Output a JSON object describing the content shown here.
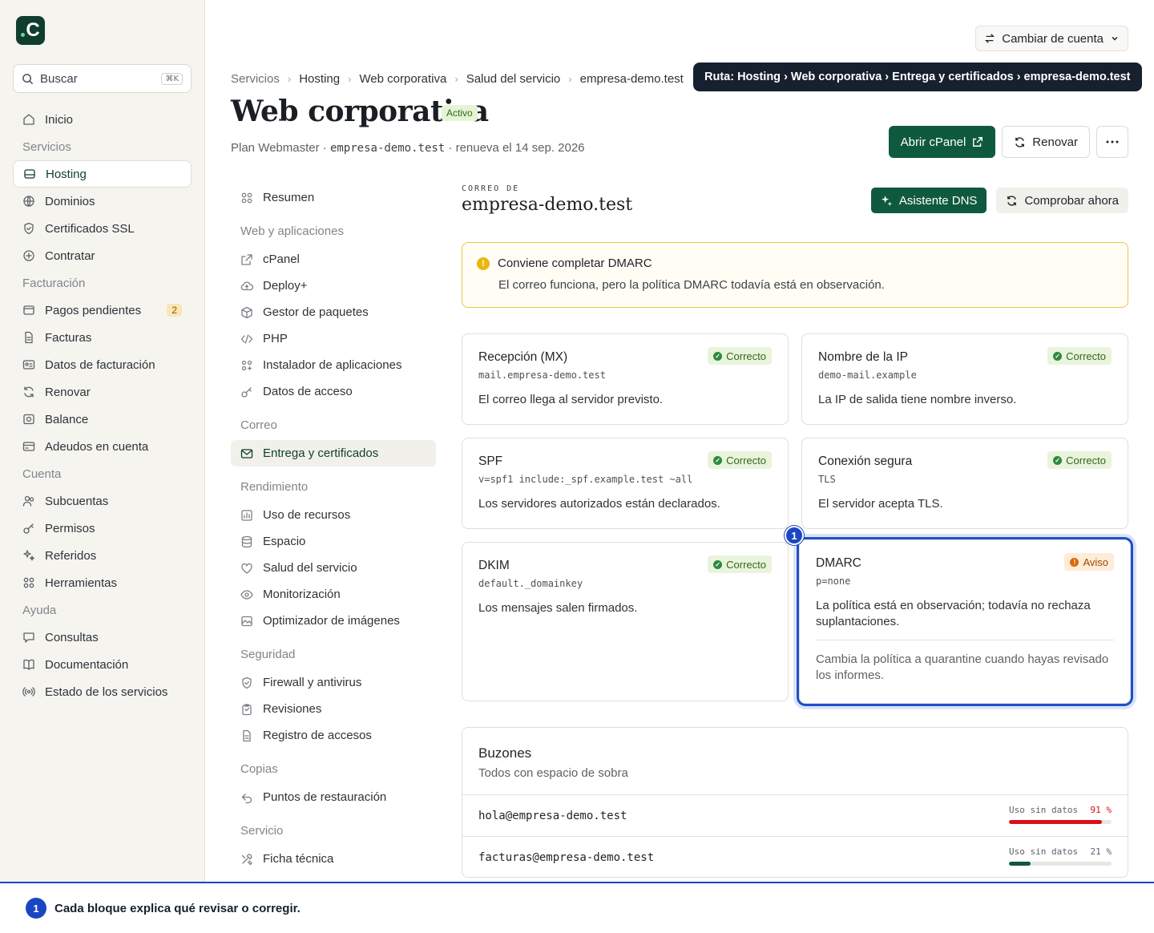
{
  "app": {
    "logo_text": "C"
  },
  "search": {
    "placeholder": "Buscar",
    "shortcut": "⌘K"
  },
  "sidebar": {
    "items": [
      {
        "type": "item",
        "label": "Inicio",
        "icon": "home-icon"
      },
      {
        "type": "section",
        "label": "Servicios"
      },
      {
        "type": "item",
        "label": "Hosting",
        "icon": "server-icon",
        "active": true
      },
      {
        "type": "item",
        "label": "Dominios",
        "icon": "globe-icon"
      },
      {
        "type": "item",
        "label": "Certificados SSL",
        "icon": "shield-icon"
      },
      {
        "type": "item",
        "label": "Contratar",
        "icon": "plus-circle-icon"
      },
      {
        "type": "section",
        "label": "Facturación"
      },
      {
        "type": "item",
        "label": "Pagos pendientes",
        "icon": "wallet-icon",
        "badge": "2"
      },
      {
        "type": "item",
        "label": "Facturas",
        "icon": "file-icon"
      },
      {
        "type": "item",
        "label": "Datos de facturación",
        "icon": "id-card-icon"
      },
      {
        "type": "item",
        "label": "Renovar",
        "icon": "refresh-icon"
      },
      {
        "type": "item",
        "label": "Balance",
        "icon": "balance-icon"
      },
      {
        "type": "item",
        "label": "Adeudos en cuenta",
        "icon": "credit-card-icon"
      },
      {
        "type": "section",
        "label": "Cuenta"
      },
      {
        "type": "item",
        "label": "Subcuentas",
        "icon": "users-icon"
      },
      {
        "type": "item",
        "label": "Permisos",
        "icon": "key-icon"
      },
      {
        "type": "item",
        "label": "Referidos",
        "icon": "sparkle-icon"
      },
      {
        "type": "item",
        "label": "Herramientas",
        "icon": "grid-icon"
      },
      {
        "type": "section",
        "label": "Ayuda"
      },
      {
        "type": "item",
        "label": "Consultas",
        "icon": "chat-icon"
      },
      {
        "type": "item",
        "label": "Documentación",
        "icon": "book-icon"
      },
      {
        "type": "item",
        "label": "Estado de los servicios",
        "icon": "broadcast-icon"
      }
    ]
  },
  "header": {
    "switch_account": "Cambiar de cuenta",
    "breadcrumb": [
      "Servicios",
      "Hosting",
      "Web corporativa",
      "Salud del servicio",
      "empresa-demo.test"
    ],
    "tooltip": "Ruta: Hosting › Web corporativa › Entrega y certificados › empresa-demo.test",
    "title": "Web corporativa",
    "status": "Activo",
    "plan_prefix": "Plan Webmaster ·",
    "plan_domain": "empresa-demo.test",
    "plan_suffix": "· renueva el 14 sep. 2026",
    "open_cpanel": "Abrir cPanel",
    "renew": "Renovar"
  },
  "subnav": {
    "items": [
      {
        "type": "item",
        "label": "Resumen",
        "icon": "grid-icon"
      },
      {
        "type": "section",
        "label": "Web y aplicaciones"
      },
      {
        "type": "item",
        "label": "cPanel",
        "icon": "external-link-icon"
      },
      {
        "type": "item",
        "label": "Deploy+",
        "icon": "cloud-upload-icon"
      },
      {
        "type": "item",
        "label": "Gestor de paquetes",
        "icon": "package-icon"
      },
      {
        "type": "item",
        "label": "PHP",
        "icon": "code-icon"
      },
      {
        "type": "item",
        "label": "Instalador de aplicaciones",
        "icon": "apps-icon"
      },
      {
        "type": "item",
        "label": "Datos de acceso",
        "icon": "key-icon"
      },
      {
        "type": "section",
        "label": "Correo"
      },
      {
        "type": "item",
        "label": "Entrega y certificados",
        "icon": "mail-icon",
        "active": true
      },
      {
        "type": "section",
        "label": "Rendimiento"
      },
      {
        "type": "item",
        "label": "Uso de recursos",
        "icon": "chart-icon"
      },
      {
        "type": "item",
        "label": "Espacio",
        "icon": "database-icon"
      },
      {
        "type": "item",
        "label": "Salud del servicio",
        "icon": "heart-icon"
      },
      {
        "type": "item",
        "label": "Monitorización",
        "icon": "eye-icon"
      },
      {
        "type": "item",
        "label": "Optimizador de imágenes",
        "icon": "image-icon"
      },
      {
        "type": "section",
        "label": "Seguridad"
      },
      {
        "type": "item",
        "label": "Firewall y antivirus",
        "icon": "shield-icon"
      },
      {
        "type": "item",
        "label": "Revisiones",
        "icon": "clipboard-icon"
      },
      {
        "type": "item",
        "label": "Registro de accesos",
        "icon": "file-icon"
      },
      {
        "type": "section",
        "label": "Copias"
      },
      {
        "type": "item",
        "label": "Puntos de restauración",
        "icon": "undo-icon"
      },
      {
        "type": "section",
        "label": "Servicio"
      },
      {
        "type": "item",
        "label": "Ficha técnica",
        "icon": "tools-icon"
      }
    ]
  },
  "panel": {
    "kicker": "CORREO DE",
    "domain": "empresa-demo.test",
    "dns_wizard": "Asistente DNS",
    "check_now": "Comprobar ahora",
    "alert_title": "Conviene completar DMARC",
    "alert_message": "El correo funciona, pero la política DMARC todavía está en observación.",
    "checks": [
      {
        "title": "Recepción (MX)",
        "code": "mail.empresa-demo.test",
        "status": "Correcto",
        "level": "ok",
        "desc": "El correo llega al servidor previsto."
      },
      {
        "title": "Nombre de la IP",
        "code": "demo-mail.example",
        "status": "Correcto",
        "level": "ok",
        "desc": "La IP de salida tiene nombre inverso."
      },
      {
        "title": "SPF",
        "code": "v=spf1 include:_spf.example.test ~all",
        "status": "Correcto",
        "level": "ok",
        "desc": "Los servidores autorizados están declarados."
      },
      {
        "title": "Conexión segura",
        "code": "TLS",
        "status": "Correcto",
        "level": "ok",
        "desc": "El servidor acepta TLS."
      },
      {
        "title": "DKIM",
        "code": "default._domainkey",
        "status": "Correcto",
        "level": "ok",
        "desc": "Los mensajes salen firmados."
      },
      {
        "title": "DMARC",
        "code": "p=none",
        "status": "Aviso",
        "level": "warn",
        "desc": "La política está en observación; todavía no rechaza suplantaciones.",
        "hint": "Cambia la política a quarantine cuando hayas revisado los informes."
      }
    ],
    "marker": "1",
    "mailboxes": {
      "title": "Buzones",
      "subtitle": "Todos con espacio de sobra",
      "rows": [
        {
          "address": "hola@empresa-demo.test",
          "usage_label": "Uso sin datos",
          "percent_label": "91 %",
          "percent": 91,
          "color": "#d8101a"
        },
        {
          "address": "facturas@empresa-demo.test",
          "usage_label": "Uso sin datos",
          "percent_label": "21 %",
          "percent": 21,
          "color": "#0f5a3e"
        }
      ]
    }
  },
  "footer": {
    "marker": "1",
    "text": "Cada bloque explica qué revisar o corregir."
  }
}
